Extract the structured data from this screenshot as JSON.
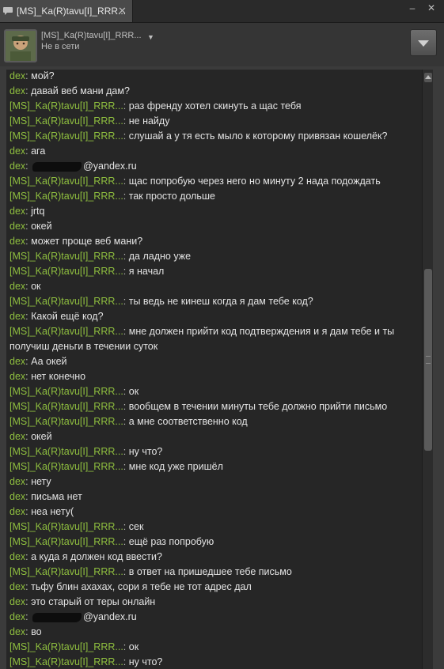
{
  "window": {
    "tab_title": "[MS]_Ka(R)tavu[I]_RRR...",
    "tab_close": "✕",
    "minimize": "–",
    "close": "✕"
  },
  "header": {
    "contact_name": "[MS]_Ka(R)tavu[I]_RRR...",
    "status": "Не в сети",
    "menu_icon": "chevron-down-icon"
  },
  "colors": {
    "sender": "#8fbf3f",
    "message_text": "#e3e3e3",
    "chat_bg": "#262626"
  },
  "messages": [
    {
      "sender": "dex",
      "text": "мой?"
    },
    {
      "sender": "dex",
      "text": "давай веб мани дам?"
    },
    {
      "sender": "[MS]_Ka(R)tavu[I]_RRR...",
      "text": "раз френду хотел скинуть а щас тебя"
    },
    {
      "sender": "[MS]_Ka(R)tavu[I]_RRR...",
      "text": "не найду"
    },
    {
      "sender": "[MS]_Ka(R)tavu[I]_RRR...",
      "text": "слушай а у тя есть мыло к которому привязан кошелёк?"
    },
    {
      "sender": "dex",
      "text": "ага"
    },
    {
      "sender": "dex",
      "text": "@yandex.ru",
      "redacted": true
    },
    {
      "sender": "[MS]_Ka(R)tavu[I]_RRR...",
      "text": "щас попробую через него но минуту 2 нада подождать"
    },
    {
      "sender": "[MS]_Ka(R)tavu[I]_RRR...",
      "text": "так просто дольше"
    },
    {
      "sender": "dex",
      "text": "jrtq"
    },
    {
      "sender": "dex",
      "text": "окей"
    },
    {
      "sender": "dex",
      "text": "может проще веб мани?"
    },
    {
      "sender": "[MS]_Ka(R)tavu[I]_RRR...",
      "text": "да ладно уже"
    },
    {
      "sender": "[MS]_Ka(R)tavu[I]_RRR...",
      "text": "я начал"
    },
    {
      "sender": "dex",
      "text": "ок"
    },
    {
      "sender": "[MS]_Ka(R)tavu[I]_RRR...",
      "text": "ты ведь не кинеш когда я дам тебе код?"
    },
    {
      "sender": "dex",
      "text": "Какой ещё код?"
    },
    {
      "sender": "[MS]_Ka(R)tavu[I]_RRR...",
      "text": "мне должен прийти код подтверждения и я дам тебе и ты получиш деньги в течении суток",
      "wrap": true
    },
    {
      "sender": "dex",
      "text": "Аа окей"
    },
    {
      "sender": "dex",
      "text": "нет конечно"
    },
    {
      "sender": "[MS]_Ka(R)tavu[I]_RRR...",
      "text": "ок"
    },
    {
      "sender": "[MS]_Ka(R)tavu[I]_RRR...",
      "text": "вообщем в течении минуты тебе должно прийти письмо"
    },
    {
      "sender": "[MS]_Ka(R)tavu[I]_RRR...",
      "text": "а мне соответственно код"
    },
    {
      "sender": "dex",
      "text": "окей"
    },
    {
      "sender": "[MS]_Ka(R)tavu[I]_RRR...",
      "text": "ну что?"
    },
    {
      "sender": "[MS]_Ka(R)tavu[I]_RRR...",
      "text": "мне код уже пришёл"
    },
    {
      "sender": "dex",
      "text": "нету"
    },
    {
      "sender": "dex",
      "text": "письма нет"
    },
    {
      "sender": "dex",
      "text": "неа нету("
    },
    {
      "sender": "[MS]_Ka(R)tavu[I]_RRR...",
      "text": "сек"
    },
    {
      "sender": "[MS]_Ka(R)tavu[I]_RRR...",
      "text": "ещё раз попробую"
    },
    {
      "sender": "dex",
      "text": "а куда я должен код ввести?"
    },
    {
      "sender": "[MS]_Ka(R)tavu[I]_RRR...",
      "text": "в ответ на пришедшее тебе письмо"
    },
    {
      "sender": "dex",
      "text": "тьфу блин ахахах, сори я тебе не тот адрес дал"
    },
    {
      "sender": "dex",
      "text": "это старый от теры онлайн"
    },
    {
      "sender": "dex",
      "text": "@yandex.ru",
      "redacted": true
    },
    {
      "sender": "dex",
      "text": "во"
    },
    {
      "sender": "[MS]_Ka(R)tavu[I]_RRR...",
      "text": "ок"
    },
    {
      "sender": "[MS]_Ka(R)tavu[I]_RRR...",
      "text": "ну что?"
    }
  ]
}
